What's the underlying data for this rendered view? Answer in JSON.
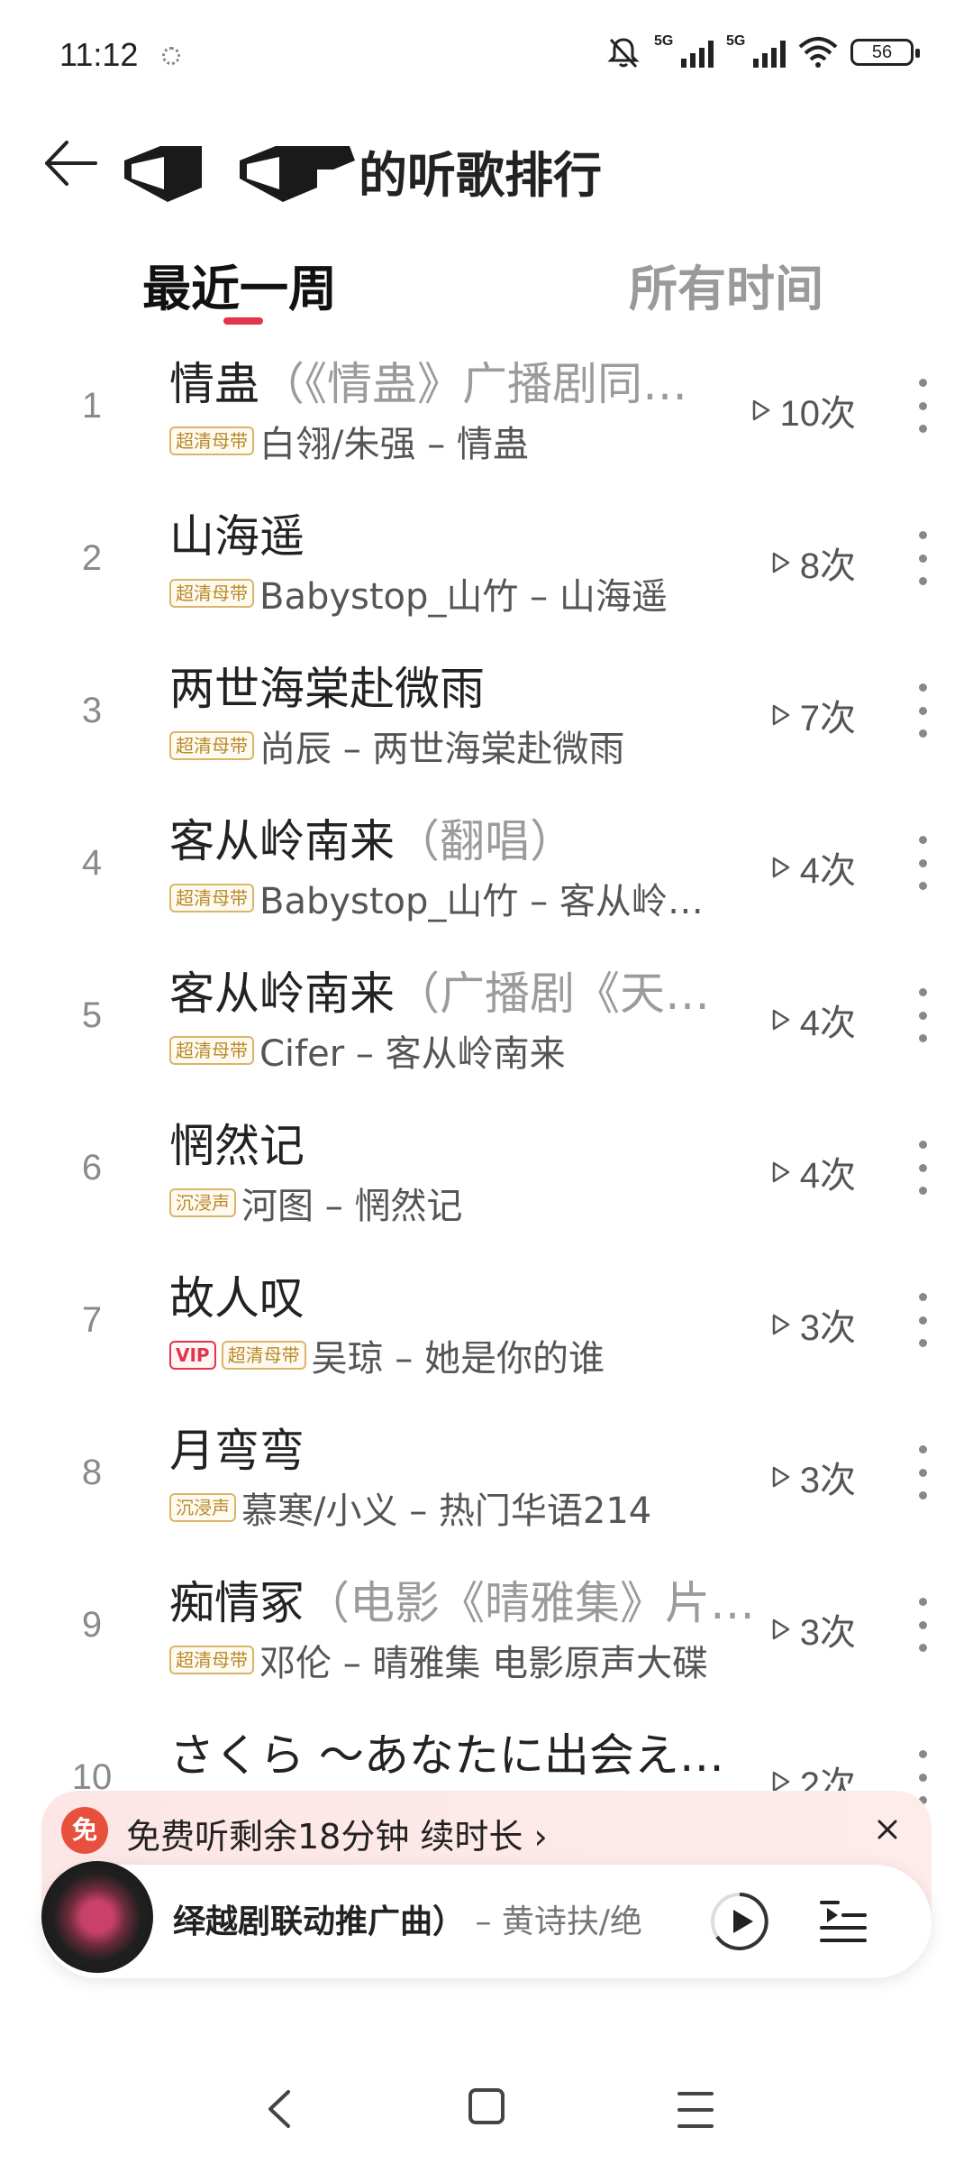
{
  "status": {
    "time": "11:12",
    "net1": "5G",
    "net2": "5G",
    "battery": "56"
  },
  "header": {
    "title_suffix": "的听歌排行"
  },
  "tabs": [
    {
      "label": "最近一周",
      "active": true
    },
    {
      "label": "所有时间",
      "active": false
    }
  ],
  "songs": [
    {
      "rank": "1",
      "title": "情蛊",
      "subtitle": "（《情蛊》广播剧同…",
      "badges": [
        "超清母带"
      ],
      "artist": "白翎/朱强 – 情蛊",
      "plays": "10次"
    },
    {
      "rank": "2",
      "title": "山海遥",
      "subtitle": "",
      "badges": [
        "超清母带"
      ],
      "artist": "Babystop_山竹 – 山海遥",
      "plays": "8次"
    },
    {
      "rank": "3",
      "title": "两世海棠赴微雨",
      "subtitle": "",
      "badges": [
        "超清母带"
      ],
      "artist": "尚辰 – 两世海棠赴微雨",
      "plays": "7次"
    },
    {
      "rank": "4",
      "title": "客从岭南来",
      "subtitle": "（翻唱）",
      "badges": [
        "超清母带"
      ],
      "artist": "Babystop_山竹 – 客从岭…",
      "plays": "4次"
    },
    {
      "rank": "5",
      "title": "客从岭南来",
      "subtitle": "（广播剧《天…",
      "badges": [
        "超清母带"
      ],
      "artist": "Cifer – 客从岭南来",
      "plays": "4次"
    },
    {
      "rank": "6",
      "title": "惘然记",
      "subtitle": "",
      "badges": [
        "沉浸声"
      ],
      "artist": "河图 – 惘然记",
      "plays": "4次"
    },
    {
      "rank": "7",
      "title": "故人叹",
      "subtitle": "",
      "badges": [
        "VIP",
        "超清母带"
      ],
      "artist": "吴琼 – 她是你的谁",
      "plays": "3次"
    },
    {
      "rank": "8",
      "title": "月弯弯",
      "subtitle": "",
      "badges": [
        "沉浸声"
      ],
      "artist": "慕寒/小义 – 热门华语214",
      "plays": "3次"
    },
    {
      "rank": "9",
      "title": "痴情冢",
      "subtitle": "（电影《晴雅集》片…",
      "badges": [
        "超清母带"
      ],
      "artist": "邓伦 – 晴雅集 电影原声大碟",
      "plays": "3次"
    },
    {
      "rank": "10",
      "title": "さくら ～あなたに出会え…",
      "subtitle": "",
      "badges": [],
      "artist": "",
      "plays": "2次"
    }
  ],
  "promo": {
    "icon_text": "免",
    "text": "免费听剩余18分钟 续时长 ›"
  },
  "player": {
    "title": "绎越剧联动推广曲）",
    "artist": " – 黄诗扶/绝"
  },
  "colors": {
    "accent": "#e2344a",
    "badge_gold": "#b88a2a"
  }
}
